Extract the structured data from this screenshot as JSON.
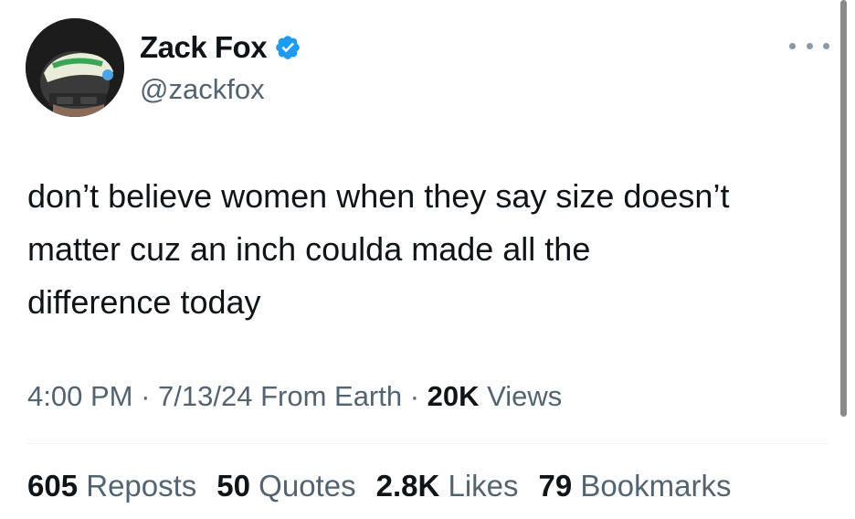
{
  "tweet": {
    "author": {
      "name": "Zack Fox",
      "handle": "@zackfox",
      "verified": true
    },
    "text": "don’t believe women when they say size doesn’t\nmatter cuz an inch coulda made all the\ndifference today",
    "meta": {
      "time": "4:00 PM",
      "separator": " · ",
      "date": "7/13/24",
      "source": "From Earth",
      "views_count": "20K",
      "views_label": " Views"
    },
    "stats": [
      {
        "count": "605",
        "label": " Reposts"
      },
      {
        "count": "50",
        "label": " Quotes"
      },
      {
        "count": "2.8K",
        "label": " Likes"
      },
      {
        "count": "79",
        "label": " Bookmarks"
      }
    ]
  },
  "icons": {
    "verified": "verified-badge-icon",
    "more": "more-options-icon"
  },
  "colors": {
    "text_primary": "#0f1419",
    "text_secondary": "#536471",
    "verified_blue": "#1d9bf0",
    "divider": "#eff3f4"
  }
}
